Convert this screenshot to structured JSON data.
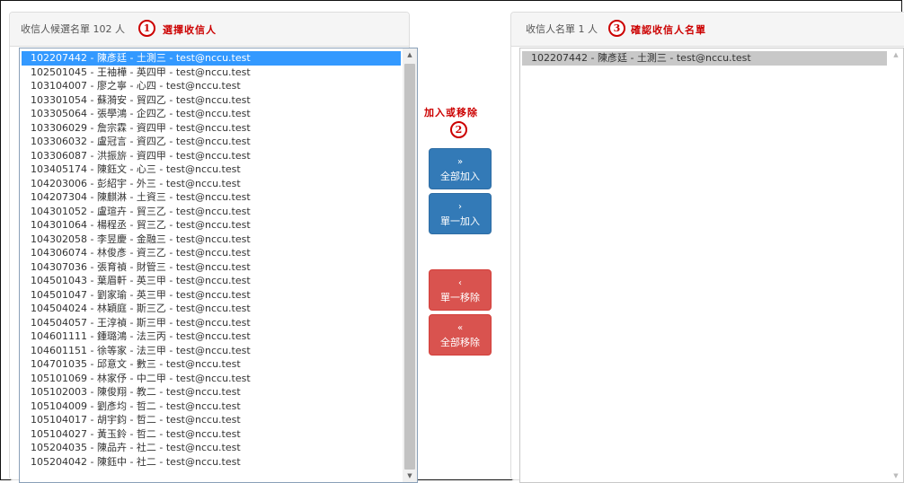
{
  "left": {
    "header_text": "收信人候選名單 102 人",
    "step_number": "1",
    "step_label": "選擇收信人",
    "items": [
      "102207442 - 陳彥廷 - 土測三 - test@nccu.test",
      "102501045 - 王袖樺 - 英四甲 - test@nccu.test",
      "103104007 - 廖之寧 - 心四 - test@nccu.test",
      "103301054 - 蘇漪安 - 貿四乙 - test@nccu.test",
      "103305064 - 張學鴻 - 企四乙 - test@nccu.test",
      "103306029 - 詹宗霖 - 資四甲 - test@nccu.test",
      "103306032 - 盧冠言 - 資四乙 - test@nccu.test",
      "103306087 - 洪振旂 - 資四甲 - test@nccu.test",
      "103405174 - 陳鈺文 - 心三 - test@nccu.test",
      "104203006 - 彭紹宇 - 外三 - test@nccu.test",
      "104207304 - 陳麒淋 - 土資三 - test@nccu.test",
      "104301052 - 盧瑄卉 - 貿三乙 - test@nccu.test",
      "104301064 - 楊程丞 - 貿三乙 - test@nccu.test",
      "104302058 - 李昱慶 - 金融三 - test@nccu.test",
      "104306074 - 林俊彥 - 資三乙 - test@nccu.test",
      "104307036 - 張育禎 - 財管三 - test@nccu.test",
      "104501043 - 葉眉軒 - 英三甲 - test@nccu.test",
      "104501047 - 劉家瑜 - 英三甲 - test@nccu.test",
      "104504024 - 林穎庭 - 斯三乙 - test@nccu.test",
      "104504057 - 王淳禎 - 斯三甲 - test@nccu.test",
      "104601111 - 鍾璐鴻 - 法三丙 - test@nccu.test",
      "104601151 - 徐等家 - 法三甲 - test@nccu.test",
      "104701035 - 邱意文 - 數三 - test@nccu.test",
      "105101069 - 林家伃 - 中二甲 - test@nccu.test",
      "105102003 - 陳俊翔 - 教二 - test@nccu.test",
      "105104009 - 劉彥均 - 哲二 - test@nccu.test",
      "105104017 - 胡宇鈞 - 哲二 - test@nccu.test",
      "105104027 - 黃玉鈴 - 哲二 - test@nccu.test",
      "105204035 - 陳品卉 - 社二 - test@nccu.test",
      "105204042 - 陳鈺中 - 社二 - test@nccu.test"
    ]
  },
  "middle": {
    "step_number": "2",
    "step_label": "加入或移除",
    "buttons": {
      "add_all": {
        "icon": "»",
        "label": "全部加入"
      },
      "add_one": {
        "icon": "›",
        "label": "單一加入"
      },
      "remove_one": {
        "icon": "‹",
        "label": "單一移除"
      },
      "remove_all": {
        "icon": "«",
        "label": "全部移除"
      }
    }
  },
  "right": {
    "header_text": "收信人名單 1 人",
    "step_number": "3",
    "step_label": "確認收信人名單",
    "items": [
      "102207442 - 陳彥廷 - 土測三 - test@nccu.test"
    ]
  },
  "colors": {
    "selected_blue": "#3399ff",
    "button_blue": "#337ab7",
    "button_red": "#d9534f",
    "annotation_red": "#cc0000"
  }
}
